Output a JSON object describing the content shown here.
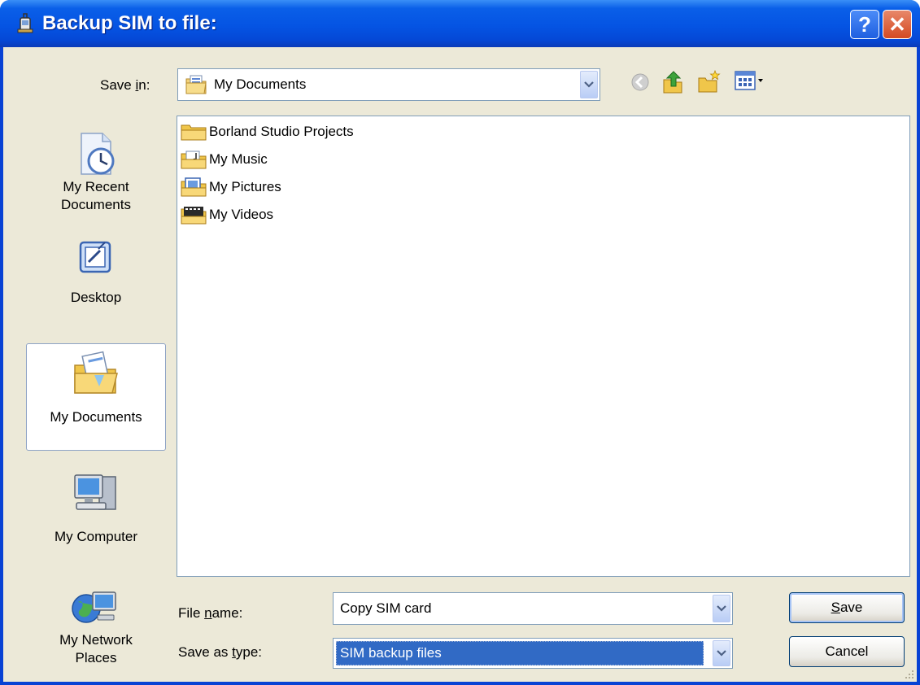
{
  "window": {
    "title": "Backup SIM to file:",
    "help_label": "?",
    "close_label": "✕"
  },
  "save_in": {
    "label_pre": "Save ",
    "label_key": "i",
    "label_post": "n:",
    "value": "My Documents"
  },
  "places": [
    {
      "label_line1": "My Recent",
      "label_line2": "Documents",
      "icon": "recent-documents-icon"
    },
    {
      "label_line1": "Desktop",
      "label_line2": "",
      "icon": "desktop-icon"
    },
    {
      "label_line1": "My Documents",
      "label_line2": "",
      "icon": "my-documents-icon"
    },
    {
      "label_line1": "My Computer",
      "label_line2": "",
      "icon": "my-computer-icon"
    },
    {
      "label_line1": "My Network",
      "label_line2": "Places",
      "icon": "network-places-icon"
    }
  ],
  "files": [
    {
      "name": "Borland Studio Projects",
      "icon": "folder-icon"
    },
    {
      "name": "My Music",
      "icon": "music-folder-icon"
    },
    {
      "name": "My Pictures",
      "icon": "pictures-folder-icon"
    },
    {
      "name": "My Videos",
      "icon": "videos-folder-icon"
    }
  ],
  "file_name": {
    "label_pre": "File ",
    "label_key": "n",
    "label_post": "ame:",
    "value": "Copy SIM card"
  },
  "save_type": {
    "label_pre": "Save as ",
    "label_key": "t",
    "label_post": "ype:",
    "value": "SIM backup files"
  },
  "buttons": {
    "save_key": "S",
    "save_rest": "ave",
    "cancel": "Cancel"
  },
  "colors": {
    "title_bar": "#0554e3",
    "dialog_face": "#ece9d8",
    "selection": "#316ac5"
  }
}
